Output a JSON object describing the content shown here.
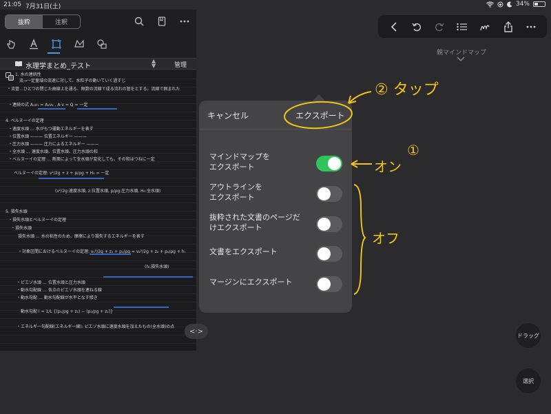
{
  "status_bar": {
    "time": "21:05",
    "date": "7月31日(土)",
    "battery": "34%",
    "battery_level": 0.34
  },
  "left_panel": {
    "segment": {
      "option_1": "抜粋",
      "option_2": "注釈"
    },
    "doc_title": "水理学まとめ_テスト",
    "manage_label": "管理",
    "note_lines": [
      "1. 水の連続性",
      "流→一定量域の流速に対して、水粒子の動いていく過すじ",
      "・流管…ひとつの閉じた曲線上を通る、無数の流線で成る流れの管をとする。流線で囲まれた",
      "・連続の式  A₁v₁ = A₂v₂ ,  A·v = Q = 一定",
      "4. ベルヌーイの定理",
      "・速度水頭 … 水がもつ運動エネルギーを表す",
      "・位置水頭 ——— 位置エネルギー ———",
      "・圧力水頭 ——— 圧力によるエネルギー ———",
      "・全水頭 … 速度水頭、位置水頭、圧力水頭の和",
      "・ベルヌーイの定理 … 断面によって全水頭が変化しても、その和はつねに一定",
      "ベルヌーイの定理:  v²/2g + z + p/ρg + H₀ = 一定",
      "(v²/2g:速度水頭, z:位置水頭, p/ρg:圧力水頭, H₀:全水頭)",
      "5. 損失水頭",
      "・損失水頭とベルヌーイの定理",
      "・損失水頭",
      "損失水頭 … 水の粘性のため、摩擦により損失するエネルギーを表す",
      "・対象区間におけるベルヌーイの定理: v₁²/2g + z₁ + p₁/ρg = v₂²/2g + z₂ + p₂/ρg + hₗ",
      "(hₗ:損失水頭)",
      "・ピエゾ水頭 … 位置水頭と圧力水頭",
      "・動水勾配線 … 各点のピエゾ水頭を連ねる線",
      "・動水勾配 … 動水勾配線が水平となす傾き",
      "動水勾配  I = 1/L {(p₁/ρg + z₁) − (p₂/ρg + z₂)}",
      "・エネルギー勾配線(エネルギー線): ピエゾ水頭に速度水頭を加えたもの(全水頭)の点"
    ]
  },
  "right_panel": {
    "mindmap_label": "親マインドマップ"
  },
  "popover": {
    "cancel_label": "キャンセル",
    "export_label": "エクスポート",
    "options": [
      {
        "label_line1": "マインドマップを",
        "label_line2": "エクスポート",
        "state": "on"
      },
      {
        "label_line1": "アウトラインを",
        "label_line2": "エクスポート",
        "state": "off"
      },
      {
        "label_line1": "抜粋された文書のページだ",
        "label_line2": "けエクスポート",
        "state": "off"
      },
      {
        "label_line1": "文書をエクスポート",
        "label_line2": "",
        "state": "off"
      },
      {
        "label_line1": "マージンにエクスポート",
        "label_line2": "",
        "state": "off"
      }
    ]
  },
  "floating_buttons": {
    "drag_label": "ドラッグ",
    "select_label": "選択",
    "nav_label": "<·>"
  },
  "annotations": {
    "step2": "② タップ",
    "step1": "①",
    "on_note": "オン",
    "off_note": "オフ",
    "color": "#f2c418"
  },
  "colors": {
    "toggle_on": "#32c45a",
    "toggle_off": "#5b5b5f",
    "highlight": "#3b6fd6"
  }
}
